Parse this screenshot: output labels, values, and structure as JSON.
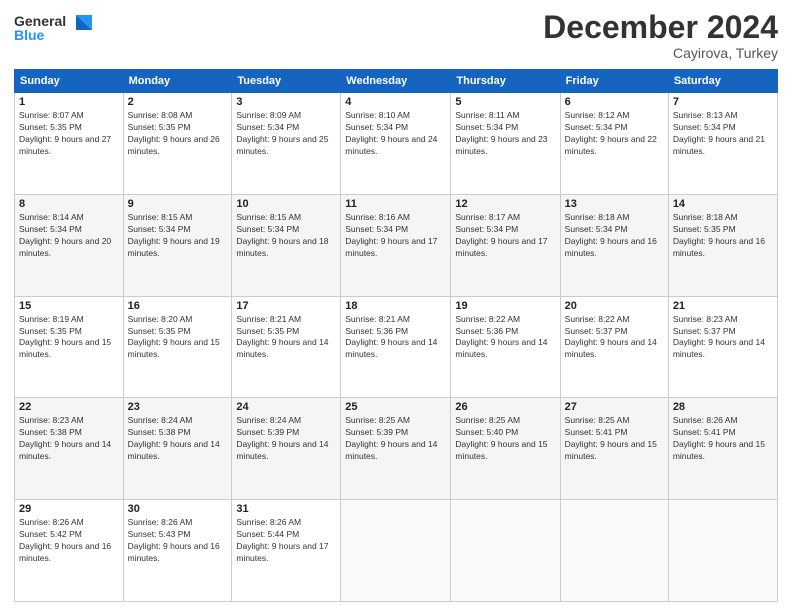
{
  "logo": {
    "line1": "General",
    "line2": "Blue"
  },
  "title": "December 2024",
  "location": "Cayirova, Turkey",
  "days_header": [
    "Sunday",
    "Monday",
    "Tuesday",
    "Wednesday",
    "Thursday",
    "Friday",
    "Saturday"
  ],
  "weeks": [
    [
      {
        "day": "1",
        "sunrise": "8:07 AM",
        "sunset": "5:35 PM",
        "daylight": "9 hours and 27 minutes."
      },
      {
        "day": "2",
        "sunrise": "8:08 AM",
        "sunset": "5:35 PM",
        "daylight": "9 hours and 26 minutes."
      },
      {
        "day": "3",
        "sunrise": "8:09 AM",
        "sunset": "5:34 PM",
        "daylight": "9 hours and 25 minutes."
      },
      {
        "day": "4",
        "sunrise": "8:10 AM",
        "sunset": "5:34 PM",
        "daylight": "9 hours and 24 minutes."
      },
      {
        "day": "5",
        "sunrise": "8:11 AM",
        "sunset": "5:34 PM",
        "daylight": "9 hours and 23 minutes."
      },
      {
        "day": "6",
        "sunrise": "8:12 AM",
        "sunset": "5:34 PM",
        "daylight": "9 hours and 22 minutes."
      },
      {
        "day": "7",
        "sunrise": "8:13 AM",
        "sunset": "5:34 PM",
        "daylight": "9 hours and 21 minutes."
      }
    ],
    [
      {
        "day": "8",
        "sunrise": "8:14 AM",
        "sunset": "5:34 PM",
        "daylight": "9 hours and 20 minutes."
      },
      {
        "day": "9",
        "sunrise": "8:15 AM",
        "sunset": "5:34 PM",
        "daylight": "9 hours and 19 minutes."
      },
      {
        "day": "10",
        "sunrise": "8:15 AM",
        "sunset": "5:34 PM",
        "daylight": "9 hours and 18 minutes."
      },
      {
        "day": "11",
        "sunrise": "8:16 AM",
        "sunset": "5:34 PM",
        "daylight": "9 hours and 17 minutes."
      },
      {
        "day": "12",
        "sunrise": "8:17 AM",
        "sunset": "5:34 PM",
        "daylight": "9 hours and 17 minutes."
      },
      {
        "day": "13",
        "sunrise": "8:18 AM",
        "sunset": "5:34 PM",
        "daylight": "9 hours and 16 minutes."
      },
      {
        "day": "14",
        "sunrise": "8:18 AM",
        "sunset": "5:35 PM",
        "daylight": "9 hours and 16 minutes."
      }
    ],
    [
      {
        "day": "15",
        "sunrise": "8:19 AM",
        "sunset": "5:35 PM",
        "daylight": "9 hours and 15 minutes."
      },
      {
        "day": "16",
        "sunrise": "8:20 AM",
        "sunset": "5:35 PM",
        "daylight": "9 hours and 15 minutes."
      },
      {
        "day": "17",
        "sunrise": "8:21 AM",
        "sunset": "5:35 PM",
        "daylight": "9 hours and 14 minutes."
      },
      {
        "day": "18",
        "sunrise": "8:21 AM",
        "sunset": "5:36 PM",
        "daylight": "9 hours and 14 minutes."
      },
      {
        "day": "19",
        "sunrise": "8:22 AM",
        "sunset": "5:36 PM",
        "daylight": "9 hours and 14 minutes."
      },
      {
        "day": "20",
        "sunrise": "8:22 AM",
        "sunset": "5:37 PM",
        "daylight": "9 hours and 14 minutes."
      },
      {
        "day": "21",
        "sunrise": "8:23 AM",
        "sunset": "5:37 PM",
        "daylight": "9 hours and 14 minutes."
      }
    ],
    [
      {
        "day": "22",
        "sunrise": "8:23 AM",
        "sunset": "5:38 PM",
        "daylight": "9 hours and 14 minutes."
      },
      {
        "day": "23",
        "sunrise": "8:24 AM",
        "sunset": "5:38 PM",
        "daylight": "9 hours and 14 minutes."
      },
      {
        "day": "24",
        "sunrise": "8:24 AM",
        "sunset": "5:39 PM",
        "daylight": "9 hours and 14 minutes."
      },
      {
        "day": "25",
        "sunrise": "8:25 AM",
        "sunset": "5:39 PM",
        "daylight": "9 hours and 14 minutes."
      },
      {
        "day": "26",
        "sunrise": "8:25 AM",
        "sunset": "5:40 PM",
        "daylight": "9 hours and 15 minutes."
      },
      {
        "day": "27",
        "sunrise": "8:25 AM",
        "sunset": "5:41 PM",
        "daylight": "9 hours and 15 minutes."
      },
      {
        "day": "28",
        "sunrise": "8:26 AM",
        "sunset": "5:41 PM",
        "daylight": "9 hours and 15 minutes."
      }
    ],
    [
      {
        "day": "29",
        "sunrise": "8:26 AM",
        "sunset": "5:42 PM",
        "daylight": "9 hours and 16 minutes."
      },
      {
        "day": "30",
        "sunrise": "8:26 AM",
        "sunset": "5:43 PM",
        "daylight": "9 hours and 16 minutes."
      },
      {
        "day": "31",
        "sunrise": "8:26 AM",
        "sunset": "5:44 PM",
        "daylight": "9 hours and 17 minutes."
      },
      null,
      null,
      null,
      null
    ]
  ],
  "labels": {
    "sunrise": "Sunrise:",
    "sunset": "Sunset:",
    "daylight": "Daylight:"
  }
}
